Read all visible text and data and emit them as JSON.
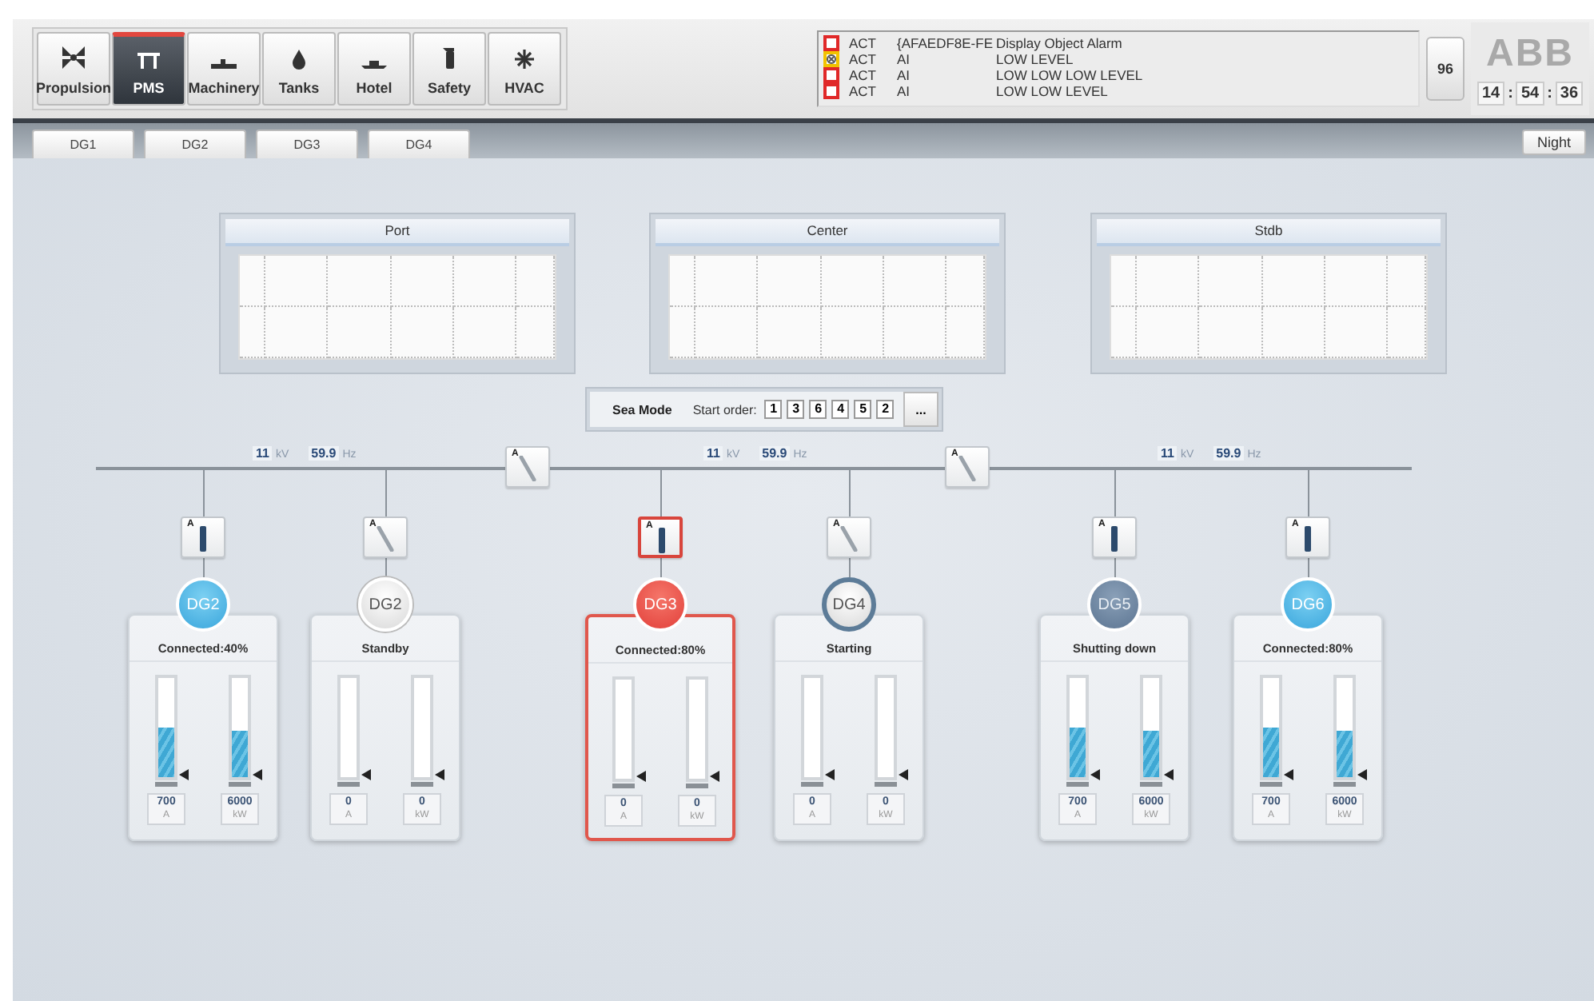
{
  "nav": [
    {
      "label": "Propulsion",
      "selected": false
    },
    {
      "label": "PMS",
      "selected": true
    },
    {
      "label": "Machinery",
      "selected": false
    },
    {
      "label": "Tanks",
      "selected": false
    },
    {
      "label": "Hotel",
      "selected": false
    },
    {
      "label": "Safety",
      "selected": false
    },
    {
      "label": "HVAC",
      "selected": false
    }
  ],
  "alarms": [
    {
      "color": "#e02828",
      "kind": "new",
      "state": "ACT",
      "type": "{AFAEDF8E-FE",
      "text": "Display Object Alarm"
    },
    {
      "color": "#f2c200",
      "kind": "acknowledged",
      "state": "ACT",
      "type": "AI",
      "text": "LOW LEVEL"
    },
    {
      "color": "#e02828",
      "kind": "new",
      "state": "ACT",
      "type": "AI",
      "text": "LOW LOW LOW LEVEL"
    },
    {
      "color": "#e02828",
      "kind": "new",
      "state": "ACT",
      "type": "AI",
      "text": "LOW LOW LEVEL"
    }
  ],
  "alarm_count": "96",
  "logo": "ABB",
  "clock": {
    "parts": [
      "14",
      "54",
      "36"
    ],
    "separator": ":"
  },
  "tabs": [
    "DG1",
    "DG2",
    "DG3",
    "DG4"
  ],
  "night_button": "Night",
  "panels": [
    {
      "title": "Port"
    },
    {
      "title": "Center"
    },
    {
      "title": "Stdb"
    }
  ],
  "sea_mode": {
    "label": "Sea Mode",
    "start_order_label": "Start order:",
    "order": [
      "1",
      "3",
      "6",
      "4",
      "5",
      "2"
    ],
    "more_button": "..."
  },
  "bus_sections": [
    {
      "voltage": "11",
      "voltage_unit": "kV",
      "frequency": "59.9",
      "frequency_unit": "Hz"
    },
    {
      "voltage": "11",
      "voltage_unit": "kV",
      "frequency": "59.9",
      "frequency_unit": "Hz"
    },
    {
      "voltage": "11",
      "voltage_unit": "kV",
      "frequency": "59.9",
      "frequency_unit": "Hz"
    }
  ],
  "bus_ties": [
    {
      "label": "A",
      "closed": false
    },
    {
      "label": "A",
      "closed": false
    }
  ],
  "generators": [
    {
      "name": "DG2",
      "kind": "connected",
      "selected": false,
      "status": "Connected:40%",
      "breaker": {
        "label": "A",
        "closed": true
      },
      "meters": [
        {
          "level": 0.5,
          "value": "700",
          "unit": "A"
        },
        {
          "level": 0.47,
          "value": "6000",
          "unit": "kW"
        }
      ]
    },
    {
      "name": "DG2",
      "kind": "standby",
      "selected": false,
      "status": "Standby",
      "breaker": {
        "label": "A",
        "closed": false
      },
      "meters": [
        {
          "value": "0",
          "unit": "A"
        },
        {
          "value": "0",
          "unit": "kW"
        }
      ]
    },
    {
      "name": "DG3",
      "kind": "alarm",
      "selected": true,
      "status": "Connected:80%",
      "breaker": {
        "label": "A",
        "closed": true
      },
      "meters": [
        {
          "value": "0",
          "unit": "A"
        },
        {
          "value": "0",
          "unit": "kW"
        }
      ]
    },
    {
      "name": "DG4",
      "kind": "starting",
      "selected": false,
      "status": "Starting",
      "breaker": {
        "label": "A",
        "closed": false
      },
      "meters": [
        {
          "value": "0",
          "unit": "A"
        },
        {
          "value": "0",
          "unit": "kW"
        }
      ]
    },
    {
      "name": "DG5",
      "kind": "shutting_down",
      "selected": false,
      "status": "Shutting down",
      "breaker": {
        "label": "A",
        "closed": true
      },
      "meters": [
        {
          "level": 0.5,
          "value": "700",
          "unit": "A"
        },
        {
          "level": 0.47,
          "value": "6000",
          "unit": "kW"
        }
      ]
    },
    {
      "name": "DG6",
      "kind": "connected",
      "selected": false,
      "status": "Connected:80%",
      "breaker": {
        "label": "A",
        "closed": true
      },
      "meters": [
        {
          "level": 0.5,
          "value": "700",
          "unit": "A"
        },
        {
          "level": 0.47,
          "value": "6000",
          "unit": "kW"
        }
      ]
    }
  ]
}
